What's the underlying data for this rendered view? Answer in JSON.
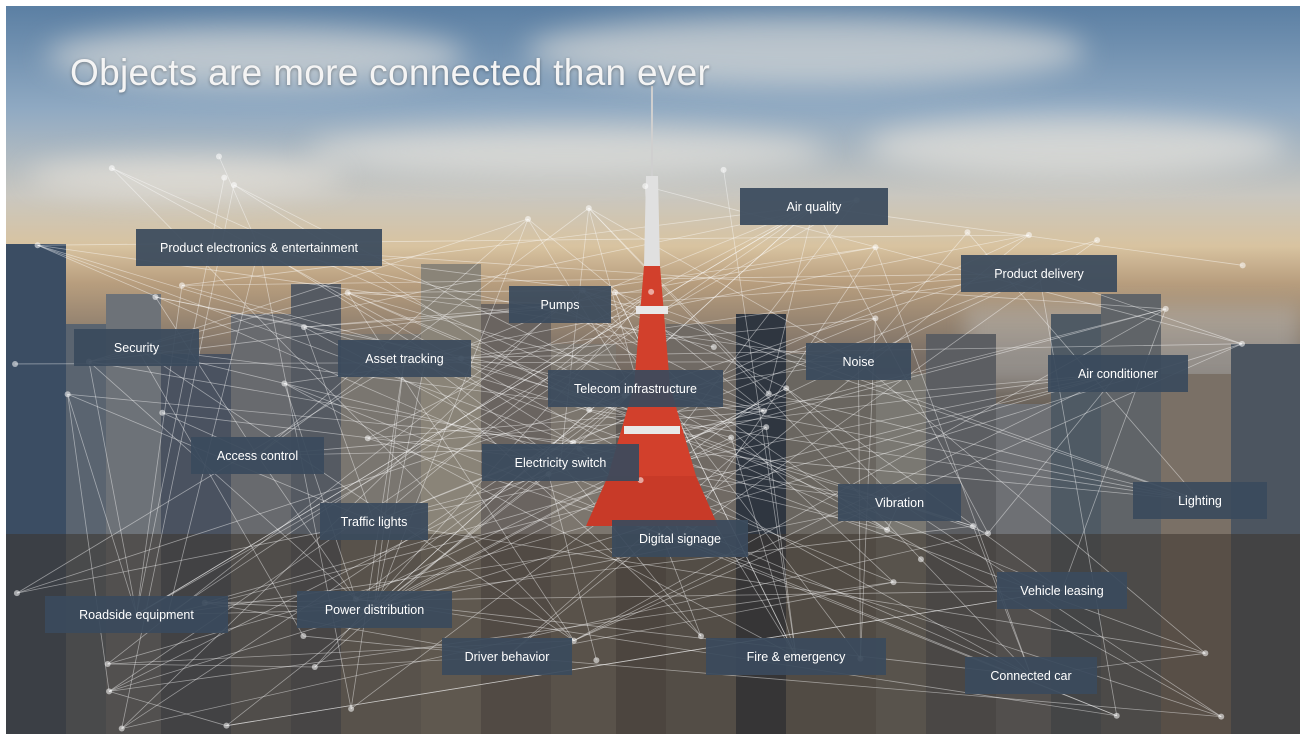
{
  "slide": {
    "title": "Objects are more connected than ever",
    "labels": [
      "Product electronics & entertainment",
      "Air quality",
      "Product delivery",
      "Pumps",
      "Security",
      "Asset tracking",
      "Noise",
      "Air conditioner",
      "Telecom infrastructure",
      "Access control",
      "Electricity switch",
      "Vibration",
      "Lighting",
      "Traffic lights",
      "Digital signage",
      "Vehicle leasing",
      "Roadside equipment",
      "Power distribution",
      "Driver behavior",
      "Fire & emergency",
      "Connected car"
    ]
  },
  "colors": {
    "label_background": "#3a4a5c",
    "label_text": "#ffffff",
    "title_text": "#f4f4f4",
    "tower_red": "#d2402c",
    "network_lines": "#ffffff"
  }
}
